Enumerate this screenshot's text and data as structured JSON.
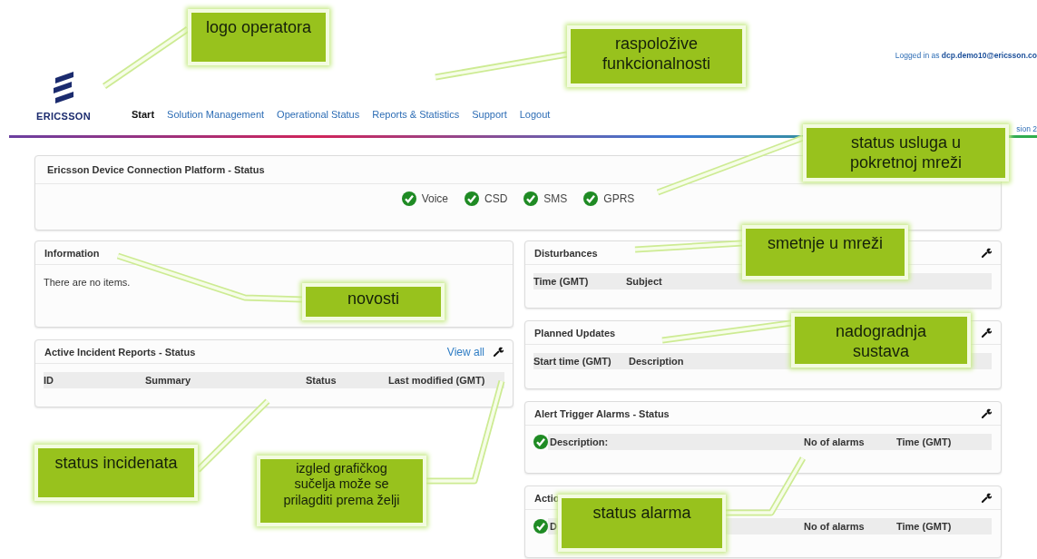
{
  "header": {
    "logo_text": "ERICSSON",
    "user_info": "Logged in as **dcp.demo10@ericsson.co**",
    "version_fragment": "sion 2"
  },
  "nav": [
    {
      "label": "Start",
      "selected": true
    },
    {
      "label": "Solution Management",
      "selected": false
    },
    {
      "label": "Operational Status",
      "selected": false
    },
    {
      "label": "Reports & Statistics",
      "selected": false
    },
    {
      "label": "Support",
      "selected": false
    },
    {
      "label": "Logout",
      "selected": false
    }
  ],
  "platform_status": {
    "title": "Ericsson Device Connection Platform - Status",
    "services": [
      {
        "label": "Voice",
        "ok": true
      },
      {
        "label": "CSD",
        "ok": true
      },
      {
        "label": "SMS",
        "ok": true
      },
      {
        "label": "GPRS",
        "ok": true
      }
    ]
  },
  "left_panels": [
    {
      "kind": "message",
      "title": "Information",
      "settings_icon": false,
      "message": "There are no items."
    },
    {
      "kind": "incidents",
      "title": "Active Incident Reports - Status",
      "link": "View all",
      "settings_icon": true,
      "columns": [
        "ID",
        "Summary",
        "Status",
        "Last modified (GMT)"
      ]
    }
  ],
  "right_panels": [
    {
      "kind": "disturbances",
      "title": "Disturbances",
      "settings_icon": true,
      "columns": [
        "Time (GMT)",
        "Subject"
      ]
    },
    {
      "kind": "updates",
      "title": "Planned Updates",
      "settings_icon": true,
      "columns": [
        "Start time (GMT)",
        "Description"
      ]
    },
    {
      "kind": "alarms",
      "title": "Alert Trigger Alarms - Status",
      "settings_icon": true,
      "ok": true,
      "columns": [
        "Description:",
        "No of alarms",
        "Time (GMT)"
      ]
    },
    {
      "kind": "alarms",
      "title": "Actio",
      "settings_icon": true,
      "ok": true,
      "columns": [
        "D",
        "No of alarms",
        "Time (GMT)"
      ]
    }
  ],
  "annotations": [
    {
      "text": "logo operatora"
    },
    {
      "text": "raspoložive funkcionalnosti"
    },
    {
      "text": "status usluga u pokretnoj mreži"
    },
    {
      "text": "smetnje u mreži"
    },
    {
      "text": "novosti"
    },
    {
      "text": "nadogradnja sustava"
    },
    {
      "text": "status incidenata"
    },
    {
      "text": "izgled grafičkog sučelja može se prilagditi prema želji"
    },
    {
      "text": "status alarma"
    }
  ]
}
